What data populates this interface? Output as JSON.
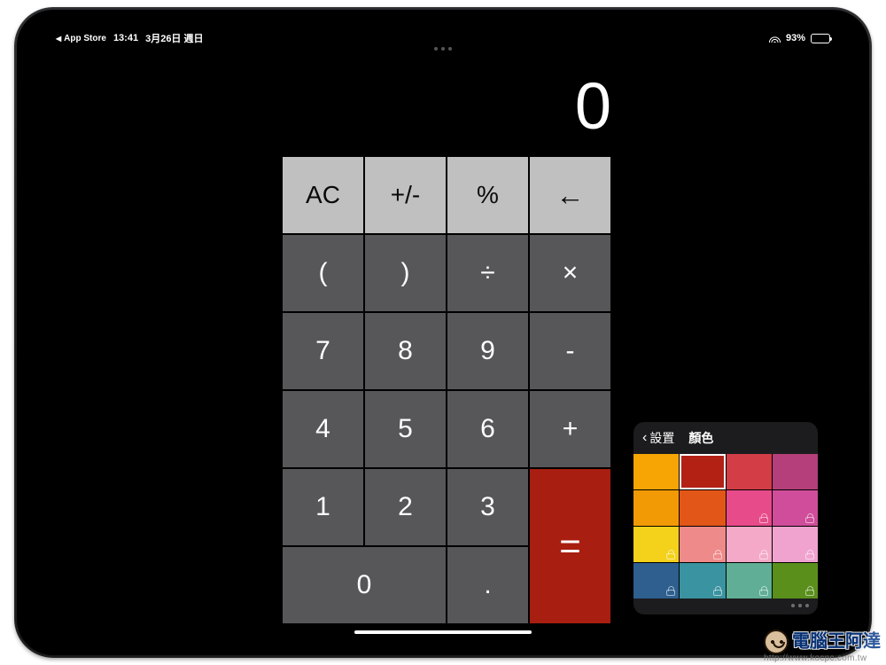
{
  "status": {
    "back_app": "App Store",
    "time": "13:41",
    "date": "3月26日 週日",
    "battery_pct": "93%"
  },
  "calc": {
    "display": "0",
    "keys": {
      "ac": "AC",
      "plusminus": "+/-",
      "percent": "%",
      "backspace": "←",
      "lparen": "(",
      "rparen": ")",
      "divide": "÷",
      "multiply": "×",
      "n7": "7",
      "n8": "8",
      "n9": "9",
      "minus": "-",
      "n4": "4",
      "n5": "5",
      "n6": "6",
      "plus": "+",
      "n1": "1",
      "n2": "2",
      "n3": "3",
      "n0": "0",
      "dot": ".",
      "equals": "="
    }
  },
  "popover": {
    "back_label": "設置",
    "title": "顏色",
    "selected_index": 1,
    "colors": [
      {
        "hex": "#f7a405",
        "locked": false
      },
      {
        "hex": "#b32115",
        "locked": false
      },
      {
        "hex": "#d23d46",
        "locked": false
      },
      {
        "hex": "#b43f7a",
        "locked": false
      },
      {
        "hex": "#f29a05",
        "locked": false
      },
      {
        "hex": "#e25717",
        "locked": false
      },
      {
        "hex": "#e84b89",
        "locked": true
      },
      {
        "hex": "#cf4d9a",
        "locked": true
      },
      {
        "hex": "#f4d11a",
        "locked": true
      },
      {
        "hex": "#ef8a8a",
        "locked": true
      },
      {
        "hex": "#f3a9c7",
        "locked": true
      },
      {
        "hex": "#f1a3d0",
        "locked": true
      },
      {
        "hex": "#2e5f8f",
        "locked": true
      },
      {
        "hex": "#3a93a0",
        "locked": true
      },
      {
        "hex": "#5fae95",
        "locked": true
      },
      {
        "hex": "#5a8f1c",
        "locked": true
      }
    ]
  },
  "watermark": {
    "title": "電腦王阿達",
    "url": "http://www.kocpc.com.tw"
  },
  "chart_data": null
}
